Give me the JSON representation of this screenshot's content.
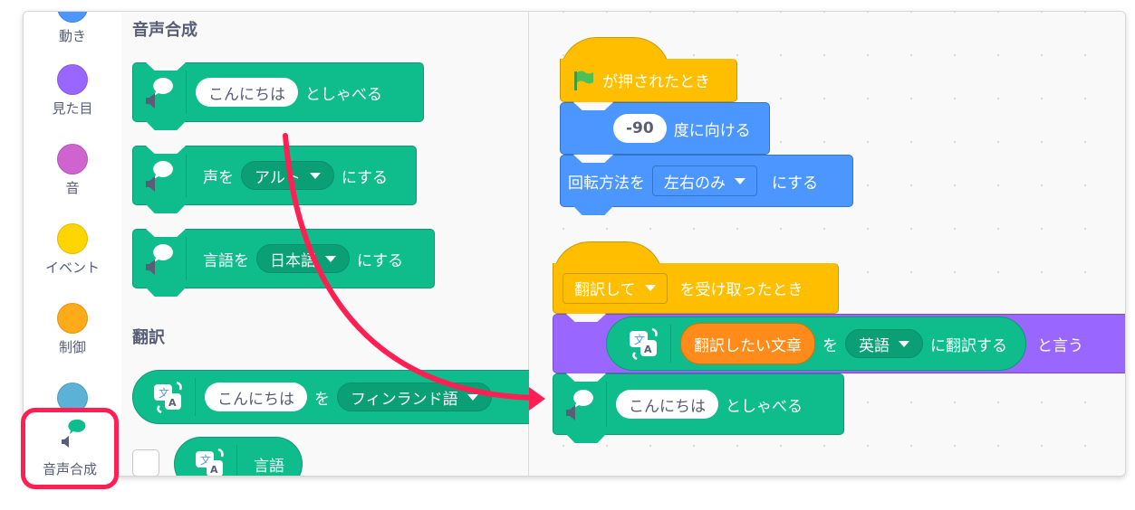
{
  "categories": [
    {
      "label": "動き",
      "color": "#4c97ff"
    },
    {
      "label": "見た目",
      "color": "#9966ff"
    },
    {
      "label": "音",
      "color": "#cf63cf"
    },
    {
      "label": "イベント",
      "color": "#ffd500"
    },
    {
      "label": "制御",
      "color": "#ffab19"
    },
    {
      "label": "",
      "color": "#5cb1d6"
    },
    {
      "label": "音声合成",
      "color": "#0fbd8c",
      "selected": true
    }
  ],
  "palette": {
    "sections": [
      {
        "title": "音声合成",
        "blocks": [
          {
            "type": "speak",
            "input": "こんにちは",
            "suffix": "としゃべる"
          },
          {
            "type": "set-voice",
            "prefix": "声を",
            "dropdown": "アルト",
            "suffix": "にする"
          },
          {
            "type": "set-language",
            "prefix": "言語を",
            "dropdown": "日本語",
            "suffix": "にする"
          }
        ]
      },
      {
        "title": "翻訳",
        "blocks": [
          {
            "type": "translate",
            "input": "こんにちは",
            "mid": "を",
            "dropdown": "フィンランド語"
          },
          {
            "type": "language-reporter",
            "label": "言語"
          }
        ]
      }
    ]
  },
  "workspace": {
    "script1": {
      "hat": {
        "label": "が押されたとき",
        "icon": "green-flag-icon"
      },
      "point": {
        "value": "-90",
        "suffix": "度に向ける"
      },
      "rotation": {
        "prefix": "回転方法を",
        "dropdown": "左右のみ",
        "suffix": "にする"
      }
    },
    "script2": {
      "hat": {
        "dropdown": "翻訳して",
        "suffix": "を受け取ったとき"
      },
      "say": {
        "translate_input": "翻訳したい文章",
        "mid": "を",
        "dropdown": "英語",
        "translate_suffix": "に翻訳する",
        "suffix": "と言う"
      },
      "speak": {
        "input": "こんにちは",
        "suffix": "としゃべる"
      }
    }
  },
  "annotation": {
    "arrow_color": "#ff1f52"
  }
}
